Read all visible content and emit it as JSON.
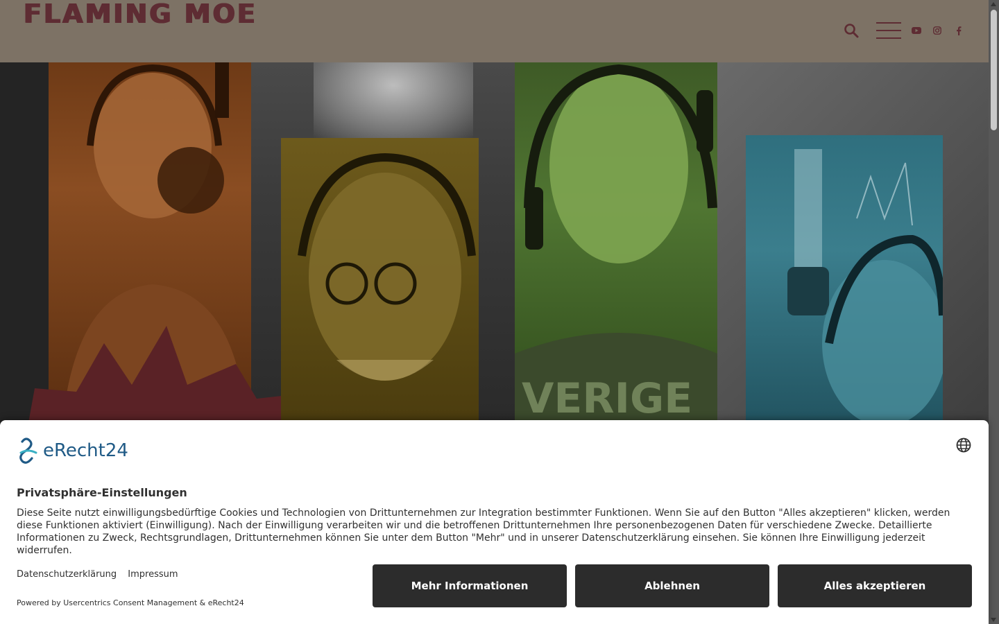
{
  "header": {
    "logo_text": "FLAMING MOE",
    "search_icon": "search-icon",
    "menu_icon": "hamburger-menu-icon",
    "social": [
      "youtube-icon",
      "instagram-icon",
      "facebook-icon"
    ],
    "background": "#7d7265",
    "accent": "#5e2c33"
  },
  "consent": {
    "logo_text": "eRecht24",
    "title": "Privatsphäre-Einstellungen",
    "text": "Diese Seite nutzt einwilligungsbedürftige Cookies und Technologien von Drittunternehmen zur Integration bestimmter Funktionen. Wenn Sie auf den Button \"Alles akzeptieren\" klicken, werden diese Funktionen aktiviert (Einwilligung). Nach der Einwilligung verarbeiten wir und die betroffenen Drittunternehmen Ihre personenbezogenen Daten für verschiedene Zwecke. Detaillierte Informationen zu Zweck, Rechtsgrundlagen, Drittunternehmen können Sie unter dem Button \"Mehr\" und in unserer Datenschutzerklärung einsehen. Sie können Ihre Einwilligung jederzeit widerrufen.",
    "link_privacy": "Datenschutzerklärung",
    "link_imprint": "Impressum",
    "powered_by": "Powered by Usercentrics Consent Management & eRecht24",
    "btn_more": "Mehr Informationen",
    "btn_decline": "Ablehnen",
    "btn_accept": "Alles akzeptieren",
    "button_color": "#2c2c2c"
  }
}
